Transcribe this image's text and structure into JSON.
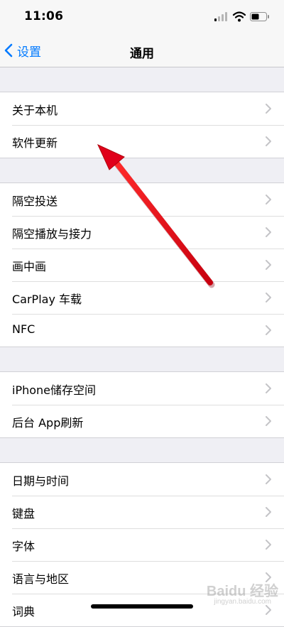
{
  "status_bar": {
    "time": "11:06"
  },
  "nav": {
    "back_label": "设置",
    "title": "通用"
  },
  "groups": [
    {
      "items": [
        {
          "label": "关于本机"
        },
        {
          "label": "软件更新"
        }
      ]
    },
    {
      "items": [
        {
          "label": "隔空投送"
        },
        {
          "label": "隔空播放与接力"
        },
        {
          "label": "画中画"
        },
        {
          "label": "CarPlay 车载"
        },
        {
          "label": "NFC"
        }
      ]
    },
    {
      "items": [
        {
          "label": "iPhone储存空间"
        },
        {
          "label": "后台 App刷新"
        }
      ]
    },
    {
      "items": [
        {
          "label": "日期与时间"
        },
        {
          "label": "键盘"
        },
        {
          "label": "字体"
        },
        {
          "label": "语言与地区"
        },
        {
          "label": "词典"
        }
      ]
    }
  ],
  "watermark": {
    "brand": "Baidu 经验",
    "url": "jingyan.baidu.com"
  },
  "colors": {
    "accent": "#007aff",
    "background": "#efeff4",
    "annotation_arrow": "#e0001a"
  }
}
